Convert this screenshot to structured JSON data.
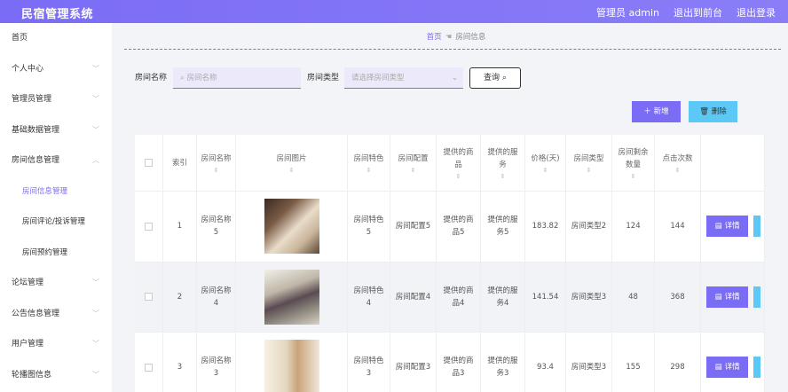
{
  "header": {
    "title": "民宿管理系统",
    "user": "管理员 admin",
    "front": "退出到前台",
    "logout": "退出登录"
  },
  "sidebar": {
    "items": [
      {
        "label": "首页",
        "sub": false,
        "chev": false,
        "active": false
      },
      {
        "label": "个人中心",
        "sub": false,
        "chev": true,
        "active": false
      },
      {
        "label": "管理员管理",
        "sub": false,
        "chev": true,
        "active": false
      },
      {
        "label": "基础数据管理",
        "sub": false,
        "chev": true,
        "active": false
      },
      {
        "label": "房间信息管理",
        "sub": false,
        "chev": true,
        "active": false
      },
      {
        "label": "房间信息管理",
        "sub": true,
        "chev": false,
        "active": true
      },
      {
        "label": "房间评论/投诉管理",
        "sub": true,
        "chev": false,
        "active": false
      },
      {
        "label": "房间预约管理",
        "sub": true,
        "chev": false,
        "active": false
      },
      {
        "label": "论坛管理",
        "sub": false,
        "chev": true,
        "active": false
      },
      {
        "label": "公告信息管理",
        "sub": false,
        "chev": true,
        "active": false
      },
      {
        "label": "用户管理",
        "sub": false,
        "chev": true,
        "active": false
      },
      {
        "label": "轮播图信息",
        "sub": false,
        "chev": true,
        "active": false
      }
    ]
  },
  "breadcrumb": {
    "home": "首页",
    "current": "房间信息"
  },
  "search": {
    "name_label": "房间名称",
    "name_placeholder": "房间名称",
    "type_label": "房间类型",
    "type_placeholder": "请选择房间类型",
    "query": "查询"
  },
  "actions": {
    "add": "新增",
    "delete": "删除"
  },
  "table": {
    "headers": [
      "索引",
      "房间名称",
      "房间图片",
      "房间特色",
      "房间配置",
      "提供的商品",
      "提供的服务",
      "价格(天)",
      "房间类型",
      "房间剩余数量",
      "点击次数"
    ],
    "detail_label": "详情",
    "rows": [
      {
        "index": "1",
        "name": "房间名称5",
        "feature": "房间特色5",
        "config": "房间配置5",
        "goods": "提供的商品5",
        "service": "提供的服务5",
        "price": "183.82",
        "type": "房间类型2",
        "remaining": "124",
        "clicks": "144",
        "img": "a"
      },
      {
        "index": "2",
        "name": "房间名称4",
        "feature": "房间特色4",
        "config": "房间配置4",
        "goods": "提供的商品4",
        "service": "提供的服务4",
        "price": "141.54",
        "type": "房间类型3",
        "remaining": "48",
        "clicks": "368",
        "img": "b"
      },
      {
        "index": "3",
        "name": "房间名称3",
        "feature": "房间特色3",
        "config": "房间配置3",
        "goods": "提供的商品3",
        "service": "提供的服务3",
        "price": "93.4",
        "type": "房间类型3",
        "remaining": "155",
        "clicks": "298",
        "img": "c"
      }
    ]
  },
  "colors": {
    "accent": "#7b6cf6",
    "cyan": "#5bc8f5"
  },
  "icons": [
    "search-icon",
    "plus-icon",
    "trash-icon",
    "detail-icon",
    "chevron-down-icon",
    "sort-icon",
    "hand-icon"
  ]
}
